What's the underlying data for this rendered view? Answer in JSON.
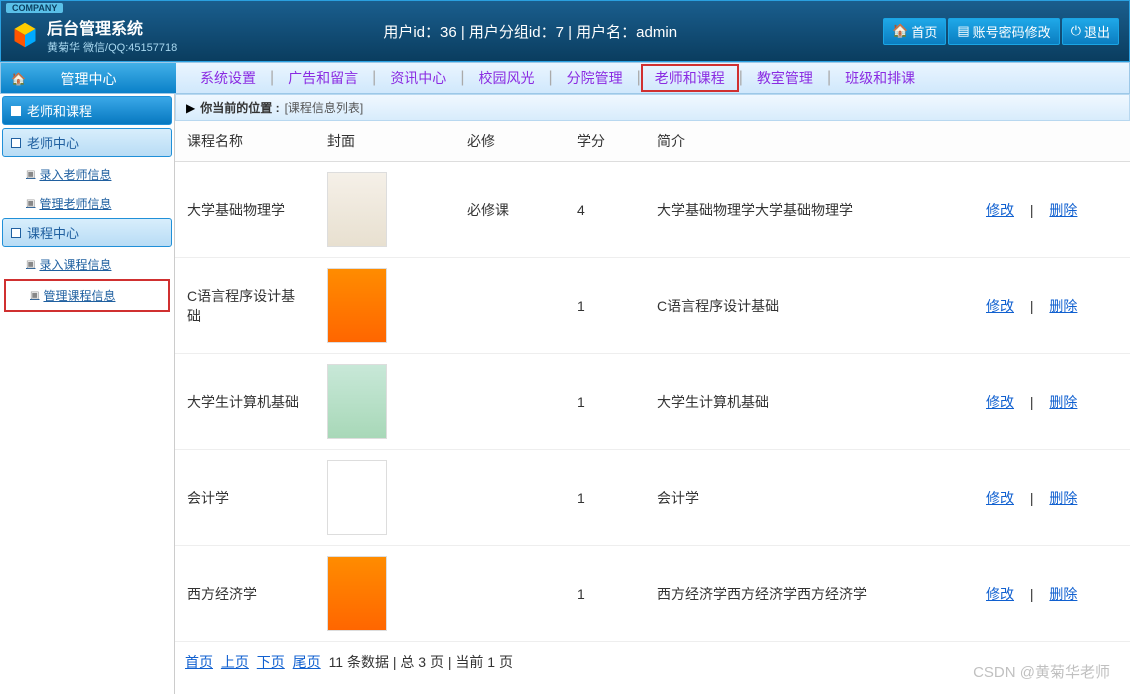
{
  "header": {
    "company_tag": "COMPANY",
    "title": "后台管理系统",
    "subtitle": "黄菊华 微信/QQ:45157718",
    "user_info": "用户id：36 | 用户分组id：7 | 用户名：admin",
    "home_btn": "首页",
    "password_btn": "账号密码修改",
    "logout_btn": "退出"
  },
  "topnav": {
    "title": "管理中心",
    "items": [
      {
        "label": "系统设置"
      },
      {
        "label": "广告和留言"
      },
      {
        "label": "资讯中心"
      },
      {
        "label": "校园风光"
      },
      {
        "label": "分院管理"
      },
      {
        "label": "老师和课程",
        "active": true
      },
      {
        "label": "教室管理"
      },
      {
        "label": "班级和排课"
      }
    ]
  },
  "sidebar": {
    "section_main": "老师和课程",
    "teacher_section": "老师中心",
    "teacher_items": [
      {
        "label": "录入老师信息"
      },
      {
        "label": "管理老师信息"
      }
    ],
    "course_section": "课程中心",
    "course_items": [
      {
        "label": "录入课程信息"
      },
      {
        "label": "管理课程信息",
        "active": true
      }
    ]
  },
  "breadcrumb": {
    "prefix": "你当前的位置 :",
    "location": "[课程信息列表]"
  },
  "table": {
    "headers": {
      "name": "课程名称",
      "cover": "封面",
      "required": "必修",
      "credit": "学分",
      "intro": "简介"
    },
    "rows": [
      {
        "name": "大学基础物理学",
        "cover_style": "beige",
        "required": "必修课",
        "credit": "4",
        "intro": "大学基础物理学大学基础物理学"
      },
      {
        "name": "C语言程序设计基础",
        "cover_style": "orange",
        "required": "",
        "credit": "1",
        "intro": "C语言程序设计基础"
      },
      {
        "name": "大学生计算机基础",
        "cover_style": "green",
        "required": "",
        "credit": "1",
        "intro": "大学生计算机基础"
      },
      {
        "name": "会计学",
        "cover_style": "white",
        "required": "",
        "credit": "1",
        "intro": "会计学"
      },
      {
        "name": "西方经济学",
        "cover_style": "orange",
        "required": "",
        "credit": "1",
        "intro": "西方经济学西方经济学西方经济学"
      }
    ],
    "actions": {
      "edit": "修改",
      "delete": "删除"
    }
  },
  "pagination": {
    "first": "首页",
    "prev": "上页",
    "next": "下页",
    "last": "尾页",
    "info": "11 条数据 | 总 3 页 | 当前 1 页"
  },
  "watermark": "CSDN @黄菊华老师"
}
